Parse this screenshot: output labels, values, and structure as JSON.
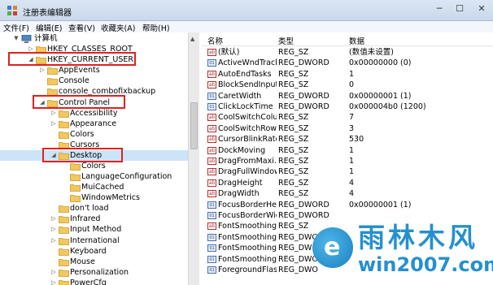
{
  "window": {
    "title": "注册表编辑器",
    "controls": {
      "minimize": "─",
      "maximize": "☐",
      "close": "✕"
    }
  },
  "menu": [
    "文件(F)",
    "编辑(E)",
    "查看(V)",
    "收藏夹(A)",
    "帮助(H)"
  ],
  "tree": {
    "root": "计算机",
    "items": [
      "HKEY_CLASSES_ROOT",
      "HKEY_CURRENT_USER",
      "AppEvents",
      "Console",
      "console_combofixbackup",
      "Control Panel",
      "Accessibility",
      "Appearance",
      "Colors",
      "Cursors",
      "Desktop",
      "Colors",
      "LanguageConfiguration",
      "MuiCached",
      "WindowMetrics",
      "don't load",
      "Infrared",
      "Input Method",
      "International",
      "Keyboard",
      "Mouse",
      "Personalization",
      "PowerCfg"
    ]
  },
  "list": {
    "headers": {
      "name": "名称",
      "type": "类型",
      "data": "数据"
    },
    "rows": [
      {
        "name": "(默认)",
        "type": "REG_SZ",
        "data": "(数值未设置)",
        "icon": "string-value-icon"
      },
      {
        "name": "ActiveWndTrack...",
        "type": "REG_DWORD",
        "data": "0x00000000 (0)",
        "icon": "binary-value-icon"
      },
      {
        "name": "AutoEndTasks",
        "type": "REG_SZ",
        "data": "1",
        "icon": "string-value-icon"
      },
      {
        "name": "BlockSendInput...",
        "type": "REG_SZ",
        "data": "0",
        "icon": "string-value-icon"
      },
      {
        "name": "CaretWidth",
        "type": "REG_DWORD",
        "data": "0x00000001 (1)",
        "icon": "binary-value-icon"
      },
      {
        "name": "ClickLockTime",
        "type": "REG_DWORD",
        "data": "0x000004b0 (1200)",
        "icon": "binary-value-icon"
      },
      {
        "name": "CoolSwitchColu...",
        "type": "REG_SZ",
        "data": "7",
        "icon": "string-value-icon"
      },
      {
        "name": "CoolSwitchRows",
        "type": "REG_SZ",
        "data": "3",
        "icon": "string-value-icon"
      },
      {
        "name": "CursorBlinkRate",
        "type": "REG_SZ",
        "data": "530",
        "icon": "string-value-icon"
      },
      {
        "name": "DockMoving",
        "type": "REG_SZ",
        "data": "1",
        "icon": "string-value-icon"
      },
      {
        "name": "DragFromMaxi...",
        "type": "REG_SZ",
        "data": "1",
        "icon": "string-value-icon"
      },
      {
        "name": "DragFullWindows",
        "type": "REG_SZ",
        "data": "1",
        "icon": "string-value-icon"
      },
      {
        "name": "DragHeight",
        "type": "REG_SZ",
        "data": "4",
        "icon": "string-value-icon"
      },
      {
        "name": "DragWidth",
        "type": "REG_SZ",
        "data": "4",
        "icon": "string-value-icon"
      },
      {
        "name": "FocusBorderHei...",
        "type": "REG_DWORD",
        "data": "0x00000001 (1)",
        "icon": "binary-value-icon"
      },
      {
        "name": "FocusBorderWid...",
        "type": "REG_DWORD",
        "data": "",
        "icon": "binary-value-icon"
      },
      {
        "name": "FontSmoothing",
        "type": "REG_SZ",
        "data": "",
        "icon": "string-value-icon"
      },
      {
        "name": "FontSmoothing...",
        "type": "REG_DWO",
        "data": "",
        "icon": "binary-value-icon"
      },
      {
        "name": "FontSmoothing...",
        "type": "REG_DWO",
        "data": "",
        "icon": "binary-value-icon"
      },
      {
        "name": "FontSmoothing...",
        "type": "REG_DWO",
        "data": "",
        "icon": "binary-value-icon"
      },
      {
        "name": "ForegroundFlas...",
        "type": "REG_DWO",
        "data": "",
        "icon": "binary-value-icon"
      }
    ]
  },
  "watermark": {
    "brand": "雨林木风",
    "url": "win2007.com"
  }
}
